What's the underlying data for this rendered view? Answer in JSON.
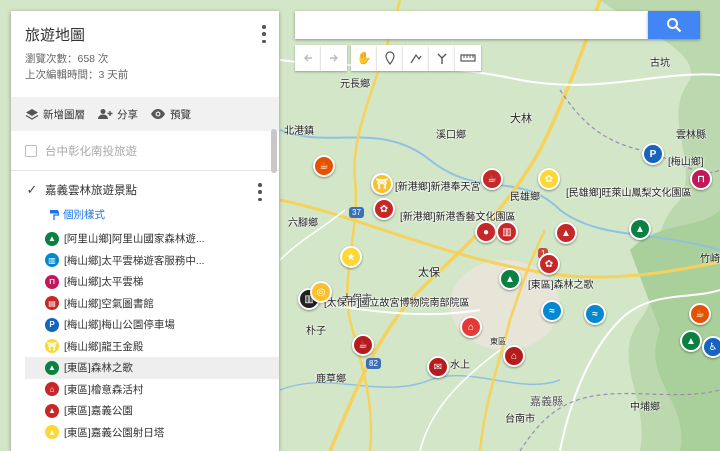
{
  "panel": {
    "title": "旅遊地圖",
    "views": "瀏覽次數：658 次",
    "edited": "上次編輯時間：3 天前",
    "toolbar": {
      "add_layer": "新增圖層",
      "share": "分享",
      "preview": "預覽"
    },
    "layer1": {
      "name": "台中彰化南投旅遊"
    },
    "layer2": {
      "name": "嘉義雲林旅遊景點",
      "style_label": "個別樣式",
      "items": [
        {
          "label": "[阿里山鄉]阿里山國家森林遊...",
          "color": "#0b8043",
          "icon": "tree-icon"
        },
        {
          "label": "[梅山鄉]太平雲梯遊客服務中...",
          "color": "#0288d1",
          "icon": "building-icon"
        },
        {
          "label": "[梅山鄉]太平雲梯",
          "color": "#c2185b",
          "icon": "bridge-icon"
        },
        {
          "label": "[梅山鄉]空氣圖書館",
          "color": "#c62828",
          "icon": "book-icon"
        },
        {
          "label": "[梅山鄉]梅山公園停車場",
          "color": "#1565c0",
          "icon": "parking-icon"
        },
        {
          "label": "[梅山鄉]龍王金殿",
          "color": "#fdd835",
          "icon": "temple-icon"
        },
        {
          "label": "[東區]森林之歌",
          "color": "#0b8043",
          "icon": "forest-icon"
        },
        {
          "label": "[東區]檜意森活村",
          "color": "#c62828",
          "icon": "house-icon"
        },
        {
          "label": "[東區]嘉義公園",
          "color": "#c62828",
          "icon": "tree-icon"
        },
        {
          "label": "[東區]嘉義公園射日塔",
          "color": "#fdd835",
          "icon": "tower-icon"
        }
      ]
    }
  },
  "search": {
    "placeholder": ""
  },
  "map": {
    "towns": [
      "元長鄉",
      "北港鎮",
      "溪口鄉",
      "大林",
      "雲林縣",
      "古坑",
      "六腳鄉",
      "民雄鄉",
      "太保",
      "太保市",
      "朴子",
      "鹿草鄉",
      "嘉義縣",
      "台南市",
      "中埔鄉",
      "竹崎",
      "水上",
      "東區"
    ],
    "place_labels": [
      "[新港鄉]新港奉天宮",
      "[新港鄉]新港香藝文化園區",
      "[民雄鄉]旺萊山鳳梨文化園區",
      "[梅山鄉]",
      "[太保市]國立故宮博物院南部院區",
      "[東區]森林之歌"
    ],
    "road_numbers": [
      "37",
      "82",
      "82",
      "1"
    ]
  },
  "colors": {
    "search_button": "#4285f4",
    "accent": "#1a73e8"
  }
}
